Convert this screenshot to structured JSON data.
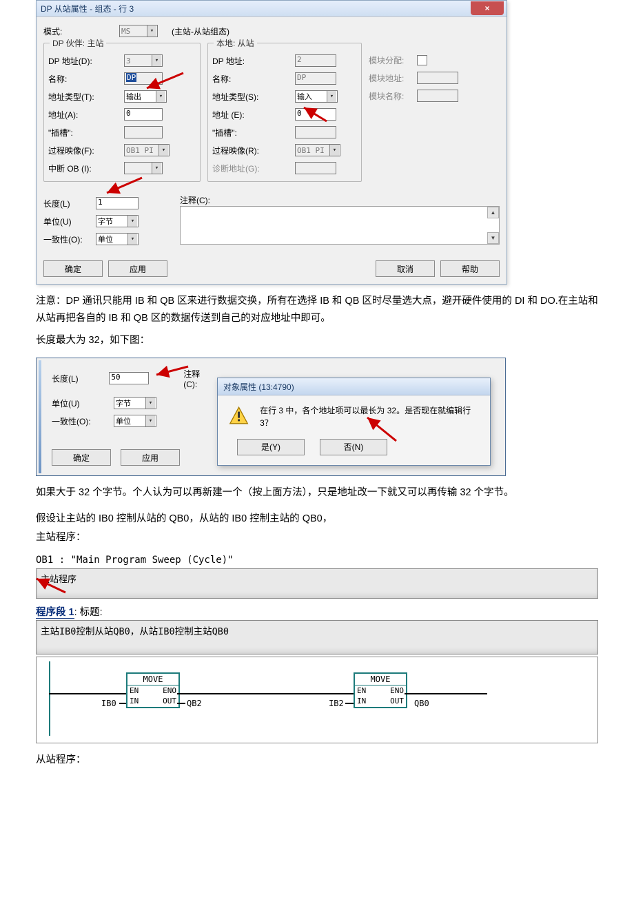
{
  "dialog1": {
    "title": "DP 从站属性 - 组态 - 行 3",
    "mode_label": "模式:",
    "mode_value": "MS",
    "mode_hint": "(主站-从站组态)",
    "master": {
      "legend": "DP 伙伴: 主站",
      "addr_d_label": "DP 地址(D):",
      "addr_d_value": "3",
      "name_label": "名称:",
      "name_value": "DP",
      "type_t_label": "地址类型(T):",
      "type_t_value": "输出",
      "addr_a_label": "地址(A):",
      "addr_a_value": "0",
      "slot_label": "\"插槽\":",
      "slot_value": "",
      "proc_f_label": "过程映像(F):",
      "proc_f_value": "OB1 PI",
      "interrupt_label": "中断 OB (I):",
      "interrupt_value": ""
    },
    "slave": {
      "legend": "本地: 从站",
      "addr_label": "DP 地址:",
      "addr_value": "2",
      "name_label": "名称:",
      "name_value": "DP",
      "type_s_label": "地址类型(S):",
      "type_s_value": "输入",
      "addr_e_label": "地址 (E):",
      "addr_e_value": "0",
      "slot_label": "\"插槽\":",
      "slot_value": "",
      "proc_r_label": "过程映像(R):",
      "proc_r_value": "OB1 PI",
      "diag_g_label": "诊断地址(G):",
      "diag_g_value": ""
    },
    "right": {
      "mod_alloc_label": "模块分配:",
      "mod_addr_label": "模块地址:",
      "mod_name_label": "模块名称:"
    },
    "bottom": {
      "len_label": "长度(L)",
      "len_value": "1",
      "comment_label": "注释(C):",
      "unit_label": "单位(U)",
      "unit_value": "字节",
      "cons_label": "一致性(O):",
      "cons_value": "单位"
    },
    "buttons": {
      "ok": "确定",
      "apply": "应用",
      "cancel": "取消",
      "help": "帮助"
    }
  },
  "text": {
    "p1": "注意：DP 通讯只能用 IB 和 QB 区来进行数据交换，所有在选择 IB 和 QB 区时尽量选大点，避开硬件使用的 DI 和 DO.在主站和从站再把各自的 IB 和 QB 区的数据传送到自己的对应地址中即可。",
    "p2": "长度最大为 32，如下图：",
    "p3": "如果大于 32 个字节。个人认为可以再新建一个（按上面方法），只是地址改一下就又可以再传输 32 个字节。",
    "p4": "假设让主站的 IB0 控制从站的 QB0，从站的 IB0 控制主站的 QB0，",
    "p5": "主站程序：",
    "p6": "从站程序："
  },
  "dialog2": {
    "len_label": "长度(L)",
    "len_value": "50",
    "comment_label": "注释(C):",
    "unit_label": "单位(U)",
    "unit_value": "字节",
    "cons_label": "一致性(O):",
    "cons_value": "单位",
    "ok": "确定",
    "apply": "应用",
    "msg_title": "对象属性 (13:4790)",
    "msg_text": "在行 3 中，各个地址项可以最长为 32。是否现在就编辑行 3？",
    "yes": "是(Y)",
    "no": "否(N)"
  },
  "code": {
    "ob1": "OB1 :  \"Main Program Sweep (Cycle)\"",
    "box1": "主站程序",
    "segment_link": "程序段 1",
    "segment_suffix": ": 标题:",
    "comment": "主站IB0控制从站QB0，从站IB0控制主站QB0",
    "move": "MOVE",
    "en": "EN",
    "eno": "ENO",
    "in": "IN",
    "out": "OUT",
    "ib0": "IB0",
    "qb2": "QB2",
    "ib2": "IB2",
    "qb0": "QB0"
  }
}
